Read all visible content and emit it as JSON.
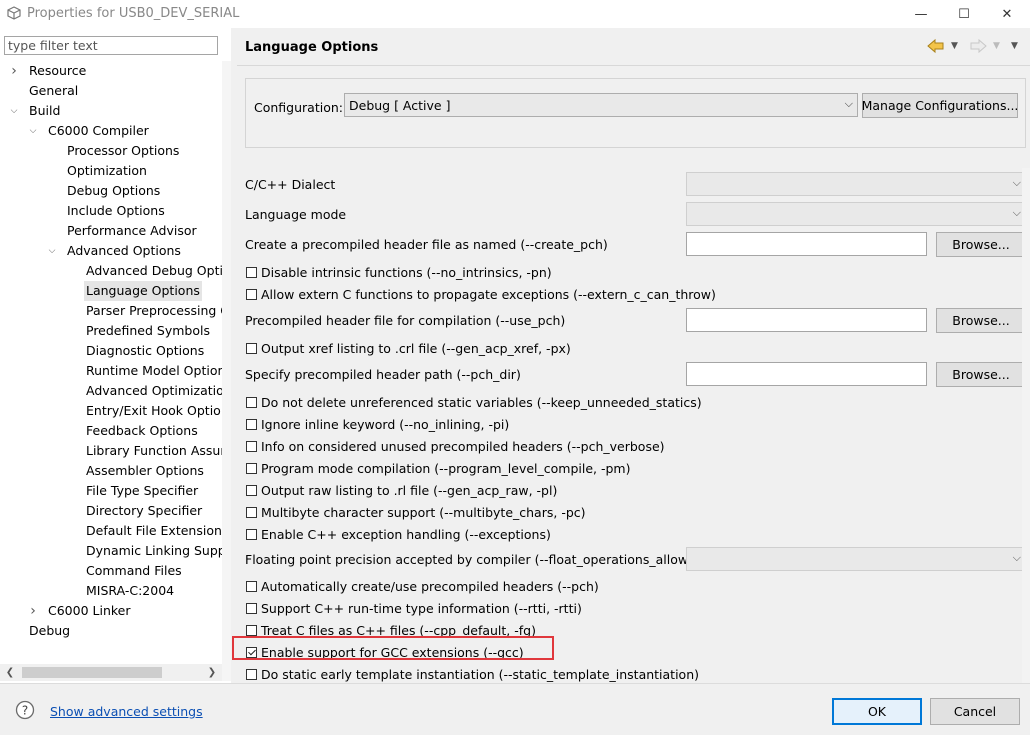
{
  "window": {
    "title": "Properties for USB0_DEV_SERIAL",
    "minimize": "—",
    "maximize": "☐",
    "close": "✕"
  },
  "filter": {
    "placeholder": "type filter text",
    "value": ""
  },
  "tree": [
    {
      "label": "Resource",
      "expander": "right"
    },
    {
      "label": "General",
      "expander": "none"
    },
    {
      "label": "Build",
      "expander": "down"
    },
    {
      "label": "C6000 Compiler",
      "expander": "down"
    },
    {
      "label": "Processor Options",
      "expander": "none"
    },
    {
      "label": "Optimization",
      "expander": "none"
    },
    {
      "label": "Debug Options",
      "expander": "none"
    },
    {
      "label": "Include Options",
      "expander": "none"
    },
    {
      "label": "Performance Advisor",
      "expander": "none"
    },
    {
      "label": "Advanced Options",
      "expander": "down"
    },
    {
      "label": "Advanced Debug Optic",
      "expander": "none"
    },
    {
      "label": "Language Options",
      "expander": "none",
      "selected": true
    },
    {
      "label": "Parser Preprocessing C",
      "expander": "none"
    },
    {
      "label": "Predefined Symbols",
      "expander": "none"
    },
    {
      "label": "Diagnostic Options",
      "expander": "none"
    },
    {
      "label": "Runtime Model Option:",
      "expander": "none"
    },
    {
      "label": "Advanced Optimization",
      "expander": "none"
    },
    {
      "label": "Entry/Exit Hook Option",
      "expander": "none"
    },
    {
      "label": "Feedback Options",
      "expander": "none"
    },
    {
      "label": "Library Function Assum",
      "expander": "none"
    },
    {
      "label": "Assembler Options",
      "expander": "none"
    },
    {
      "label": "File Type Specifier",
      "expander": "none"
    },
    {
      "label": "Directory Specifier",
      "expander": "none"
    },
    {
      "label": "Default File Extensions",
      "expander": "none"
    },
    {
      "label": "Dynamic Linking Suppo",
      "expander": "none"
    },
    {
      "label": "Command Files",
      "expander": "none"
    },
    {
      "label": "MISRA-C:2004",
      "expander": "none"
    },
    {
      "label": "C6000 Linker",
      "expander": "right"
    },
    {
      "label": "Debug",
      "expander": "none"
    }
  ],
  "page": {
    "title": "Language Options",
    "config_label": "Configuration:",
    "config_value": "Debug  [ Active ]",
    "manage_label": "Manage Configurations..."
  },
  "options": [
    {
      "kind": "combo",
      "label": "C/C++ Dialect",
      "value": ""
    },
    {
      "kind": "combo",
      "label": "Language mode",
      "value": ""
    },
    {
      "kind": "text",
      "label": "Create a precompiled header file as named (--create_pch)",
      "value": "",
      "button": "Browse..."
    },
    {
      "kind": "check",
      "label": "Disable intrinsic functions (--no_intrinsics, -pn)",
      "checked": false
    },
    {
      "kind": "check",
      "label": "Allow extern C functions to propagate exceptions (--extern_c_can_throw)",
      "checked": false
    },
    {
      "kind": "text",
      "label": "Precompiled header file for compilation (--use_pch)",
      "value": "",
      "button": "Browse..."
    },
    {
      "kind": "check",
      "label": "Output xref listing to .crl file (--gen_acp_xref, -px)",
      "checked": false
    },
    {
      "kind": "text",
      "label": "Specify precompiled header path (--pch_dir)",
      "value": "",
      "button": "Browse..."
    },
    {
      "kind": "check",
      "label": "Do not delete unreferenced static variables (--keep_unneeded_statics)",
      "checked": false
    },
    {
      "kind": "check",
      "label": "Ignore inline keyword (--no_inlining, -pi)",
      "checked": false
    },
    {
      "kind": "check",
      "label": "Info on considered  unused precompiled headers (--pch_verbose)",
      "checked": false
    },
    {
      "kind": "check",
      "label": "Program mode compilation (--program_level_compile, -pm)",
      "checked": false
    },
    {
      "kind": "check",
      "label": "Output raw listing to .rl file (--gen_acp_raw, -pl)",
      "checked": false
    },
    {
      "kind": "check",
      "label": "Multibyte character support (--multibyte_chars, -pc)",
      "checked": false
    },
    {
      "kind": "check",
      "label": "Enable C++ exception handling (--exceptions)",
      "checked": false
    },
    {
      "kind": "combo",
      "label": "Floating point precision accepted by compiler (--float_operations_allowed)",
      "value": ""
    },
    {
      "kind": "check",
      "label": "Automatically create/use precompiled headers (--pch)",
      "checked": false
    },
    {
      "kind": "check",
      "label": "Support C++ run-time type information (--rtti, -rtti)",
      "checked": false
    },
    {
      "kind": "check",
      "label": "Treat C files as C++ files (--cpp_default, -fg)",
      "checked": false
    },
    {
      "kind": "check",
      "label": "Enable support for GCC extensions (--gcc)",
      "checked": true,
      "highlighted": true
    },
    {
      "kind": "check",
      "label": "Do static early template instantiation (--static_template_instantiation)",
      "checked": false
    }
  ],
  "footer": {
    "advanced_link": "Show advanced settings",
    "ok_label": "OK",
    "cancel_label": "Cancel"
  },
  "colors": {
    "highlight_box": "#e0373c",
    "link": "#0b4fb3",
    "default_button_border": "#0078d7"
  },
  "icons": {
    "app": "properties-app-icon",
    "help": "help-icon",
    "back": "back-arrow-icon",
    "forward": "forward-arrow-icon"
  }
}
